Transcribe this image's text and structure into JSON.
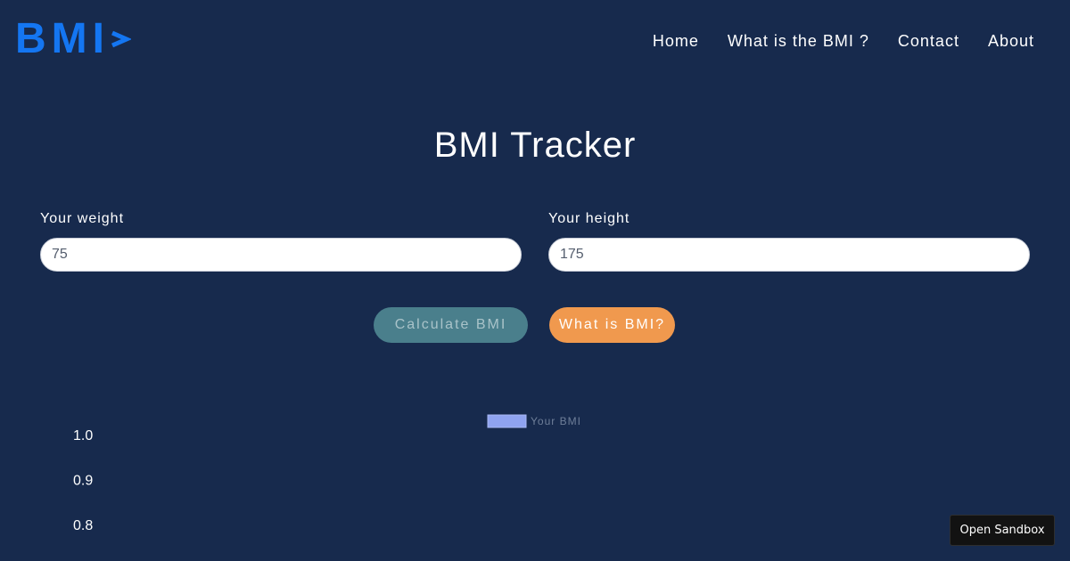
{
  "header": {
    "logo_text": "BMI",
    "logo_icon": "chevron-right-icon",
    "nav": [
      {
        "label": "Home"
      },
      {
        "label": "What is the BMI ?"
      },
      {
        "label": "Contact"
      },
      {
        "label": "About"
      }
    ]
  },
  "main": {
    "title": "BMI Tracker",
    "weight": {
      "label": "Your weight",
      "value": "75"
    },
    "height": {
      "label": "Your height",
      "value": "175"
    },
    "buttons": {
      "calculate": "Calculate BMI",
      "what": "What is BMI?"
    }
  },
  "chart_data": {
    "type": "line",
    "series": [
      {
        "name": "Your BMI",
        "values": []
      }
    ],
    "x": [],
    "yticks": [
      "1.0",
      "0.9",
      "0.8"
    ],
    "legend_position": "top-center"
  },
  "sandbox": {
    "label": "Open Sandbox"
  },
  "colors": {
    "background": "#172a4d",
    "logo": "#1476f2",
    "calculate_button": "#4a7f8c",
    "what_button": "#f0994e",
    "legend_swatch": "#8fa3f0"
  }
}
